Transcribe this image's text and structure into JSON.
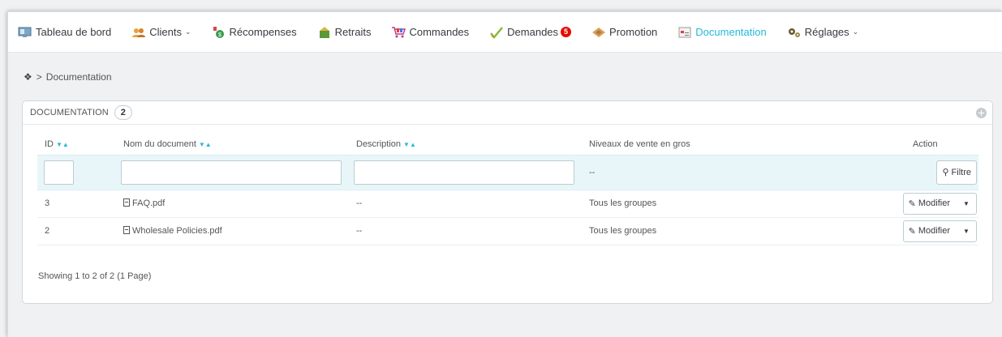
{
  "nav": [
    {
      "label": "Tableau de bord",
      "icon": "dashboard-icon",
      "caret": false,
      "active": false
    },
    {
      "label": "Clients",
      "icon": "clients-icon",
      "caret": true,
      "active": false
    },
    {
      "label": "Récompenses",
      "icon": "rewards-icon",
      "caret": false,
      "active": false
    },
    {
      "label": "Retraits",
      "icon": "withdrawals-icon",
      "caret": false,
      "active": false
    },
    {
      "label": "Commandes",
      "icon": "orders-icon",
      "caret": false,
      "active": false
    },
    {
      "label": "Demandes",
      "icon": "requests-icon",
      "caret": false,
      "active": false,
      "badge": "5"
    },
    {
      "label": "Promotion",
      "icon": "promotion-icon",
      "caret": false,
      "active": false
    },
    {
      "label": "Documentation",
      "icon": "documentation-icon",
      "caret": false,
      "active": true
    },
    {
      "label": "Réglages",
      "icon": "settings-icon",
      "caret": true,
      "active": false
    }
  ],
  "breadcrumb": {
    "home_icon": "home-icon",
    "separator": ">",
    "current": "Documentation"
  },
  "panel": {
    "title": "DOCUMENTATION",
    "count": "2",
    "columns": [
      "ID",
      "Nom du document",
      "Description",
      "Niveaux de vente en gros",
      "Action"
    ],
    "filter": {
      "levels_placeholder": "--",
      "filter_button": "Filtre"
    },
    "rows": [
      {
        "id": "3",
        "name": "FAQ.pdf",
        "description": "--",
        "levels": "Tous les groupes",
        "action": "Modifier"
      },
      {
        "id": "2",
        "name": "Wholesale Policies.pdf",
        "description": "--",
        "levels": "Tous les groupes",
        "action": "Modifier"
      }
    ],
    "footer": "Showing 1 to 2 of 2 (1 Page)"
  },
  "colors": {
    "accent": "#25b9d7",
    "badge": "#e50b00"
  }
}
